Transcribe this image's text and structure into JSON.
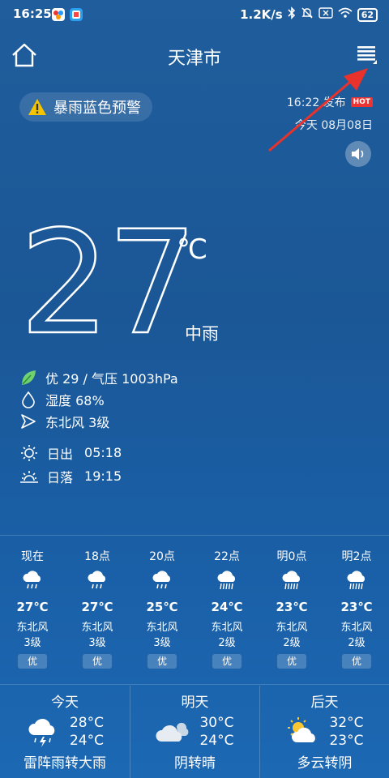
{
  "status_bar": {
    "time": "16:25",
    "network_speed": "1.2K/s",
    "battery": "62"
  },
  "header": {
    "city": "天津市"
  },
  "alert": {
    "text": "暴雨蓝色预警"
  },
  "publish": {
    "time": "16:22 发布",
    "hot_badge": "HOT",
    "date": "今天 08月08日"
  },
  "current": {
    "temperature": "27",
    "unit": "℃",
    "condition": "中雨",
    "aqi_pressure": "优 29 / 气压 1003hPa",
    "humidity": "湿度 68%",
    "wind": "东北风 3级"
  },
  "sun": {
    "sunrise_label": "日出",
    "sunrise": "05:18",
    "sunset_label": "日落",
    "sunset": "19:15"
  },
  "hourly": [
    {
      "time": "现在",
      "temp": "27℃",
      "wind_dir": "东北风",
      "wind_level": "3级",
      "aqi": "优",
      "icon": "rain-icon"
    },
    {
      "time": "18点",
      "temp": "27℃",
      "wind_dir": "东北风",
      "wind_level": "3级",
      "aqi": "优",
      "icon": "rain-icon"
    },
    {
      "time": "20点",
      "temp": "25℃",
      "wind_dir": "东北风",
      "wind_level": "3级",
      "aqi": "优",
      "icon": "rain-icon"
    },
    {
      "time": "22点",
      "temp": "24℃",
      "wind_dir": "东北风",
      "wind_level": "2级",
      "aqi": "优",
      "icon": "heavy-rain-icon"
    },
    {
      "time": "明0点",
      "temp": "23℃",
      "wind_dir": "东北风",
      "wind_level": "2级",
      "aqi": "优",
      "icon": "heavy-rain-icon"
    },
    {
      "time": "明2点",
      "temp": "23℃",
      "wind_dir": "东北风",
      "wind_level": "2级",
      "aqi": "优",
      "icon": "heavy-rain-icon"
    }
  ],
  "daily": [
    {
      "day": "今天",
      "high": "28°C",
      "low": "24°C",
      "condition": "雷阵雨转大雨",
      "icon": "thunderstorm-icon"
    },
    {
      "day": "明天",
      "high": "30°C",
      "low": "24°C",
      "condition": "阴转晴",
      "icon": "cloudy-icon"
    },
    {
      "day": "后天",
      "high": "32°C",
      "low": "23°C",
      "condition": "多云转阴",
      "icon": "partly-cloudy-icon"
    }
  ],
  "colors": {
    "background_top": "#1f5d9c",
    "background_bottom": "#1c68b3",
    "hot_badge": "#ee3333",
    "annotation_arrow": "#e8322b",
    "leaf": "#6fd16f",
    "warning_triangle": "#f5c400"
  }
}
